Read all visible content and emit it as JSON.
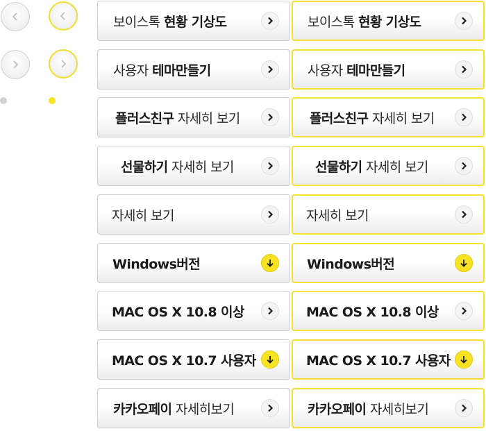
{
  "nav_circles": {
    "prev_icon": "chevron-left-icon",
    "next_icon": "chevron-right-icon",
    "indicator_inactive_color": "#d2d2d2",
    "indicator_active_color": "#f7e223"
  },
  "buttons": [
    {
      "parts": [
        {
          "text": "보이스톡 ",
          "bold": false
        },
        {
          "text": "현황 기상도",
          "bold": true
        }
      ],
      "icon": "arrow-right-icon"
    },
    {
      "parts": [
        {
          "text": "사용자 ",
          "bold": false
        },
        {
          "text": "테마만들기",
          "bold": true
        }
      ],
      "icon": "arrow-right-icon"
    },
    {
      "parts": [
        {
          "text": "플러스친구",
          "bold": true
        },
        {
          "text": " 자세히 보기",
          "bold": false
        }
      ],
      "icon": "arrow-right-icon"
    },
    {
      "parts": [
        {
          "text": "선물하기",
          "bold": true
        },
        {
          "text": " 자세히 보기",
          "bold": false
        }
      ],
      "icon": "arrow-right-icon"
    },
    {
      "parts": [
        {
          "text": "자세히 보기",
          "bold": false
        }
      ],
      "icon": "arrow-right-icon"
    },
    {
      "parts": [
        {
          "text": "Windows버전",
          "bold": true
        }
      ],
      "icon": "download-icon"
    },
    {
      "parts": [
        {
          "text": "MAC OS X 10.8 이상",
          "bold": true
        }
      ],
      "icon": "arrow-right-icon"
    },
    {
      "parts": [
        {
          "text": "MAC OS X 10.7 사용자",
          "bold": true
        }
      ],
      "icon": "download-icon"
    },
    {
      "parts": [
        {
          "text": "카카오페이",
          "bold": true
        },
        {
          "text": " 자세히보기",
          "bold": false
        }
      ],
      "icon": "arrow-right-icon"
    }
  ],
  "colors": {
    "highlight_border": "#f4e32e",
    "download_icon_bg": "#f7e223",
    "default_border": "#cfcfcf"
  }
}
